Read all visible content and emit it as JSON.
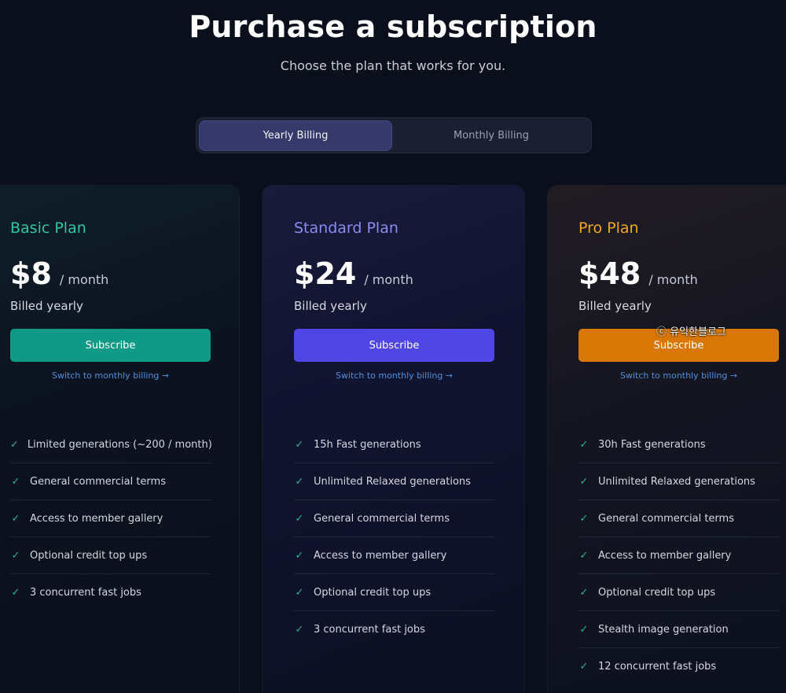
{
  "header": {
    "title": "Purchase a subscription",
    "subtitle": "Choose the plan that works for you."
  },
  "billing_toggle": {
    "options": [
      {
        "label": "Yearly Billing",
        "selected": true
      },
      {
        "label": "Monthly Billing",
        "selected": false
      }
    ]
  },
  "plans": [
    {
      "name": "Basic Plan",
      "name_color": "#2ec7a6",
      "price": "$8",
      "period": "/ month",
      "billed": "Billed yearly",
      "button_label": "Subscribe",
      "button_color": "#0e9a85",
      "switch_link": "Switch to monthly billing →",
      "features": [
        "Limited generations (~200 / month)",
        "General commercial terms",
        "Access to member gallery",
        "Optional credit top ups",
        "3 concurrent fast jobs"
      ]
    },
    {
      "name": "Standard Plan",
      "name_color": "#8a8cf2",
      "price": "$24",
      "period": "/ month",
      "billed": "Billed yearly",
      "button_label": "Subscribe",
      "button_color": "#4f46e5",
      "switch_link": "Switch to monthly billing →",
      "features": [
        "15h Fast generations",
        "Unlimited Relaxed generations",
        "General commercial terms",
        "Access to member gallery",
        "Optional credit top ups",
        "3 concurrent fast jobs"
      ]
    },
    {
      "name": "Pro Plan",
      "name_color": "#f5a623",
      "price": "$48",
      "period": "/ month",
      "billed": "Billed yearly",
      "button_label": "Subscribe",
      "button_color": "#d97706",
      "switch_link": "Switch to monthly billing →",
      "features": [
        "30h Fast generations",
        "Unlimited Relaxed generations",
        "General commercial terms",
        "Access to member gallery",
        "Optional credit top ups",
        "Stealth image generation",
        "12 concurrent fast jobs"
      ]
    }
  ],
  "watermark": "ⓒ 유익한블로그"
}
